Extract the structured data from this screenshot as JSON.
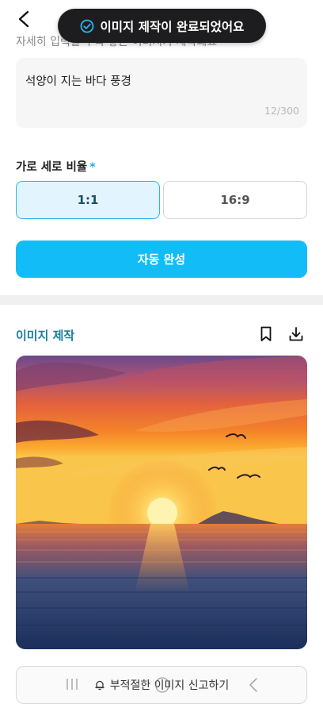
{
  "header": {
    "back_icon": "chevron-left-icon"
  },
  "hint": "자세히 입력할 수록 좋은 이미지가 제작돼요",
  "toast": {
    "icon": "check-circle-icon",
    "text": "이미지 제작이 완료되었어요"
  },
  "prompt": {
    "value": "석양이 지는 바다 풍경",
    "char_count": "12/300"
  },
  "ratio": {
    "label": "가로 세로 비율",
    "required_mark": "*",
    "options": [
      {
        "label": "1:1",
        "selected": true
      },
      {
        "label": "16:9",
        "selected": false
      }
    ]
  },
  "auto_complete": {
    "label": "자동 완성"
  },
  "result": {
    "title": "이미지 제작",
    "bookmark_icon": "bookmark-icon",
    "download_icon": "download-icon",
    "image_subject": "sunset-over-sea"
  },
  "report": {
    "icon": "bell-icon",
    "label": "부적절한 이미지 신고하기"
  },
  "colors": {
    "accent": "#12bdf7",
    "selected_bg": "#e2f4fd",
    "selected_border": "#29b6ec",
    "title_teal": "#1a7fa0",
    "toast_bg": "#1d1d1f"
  }
}
